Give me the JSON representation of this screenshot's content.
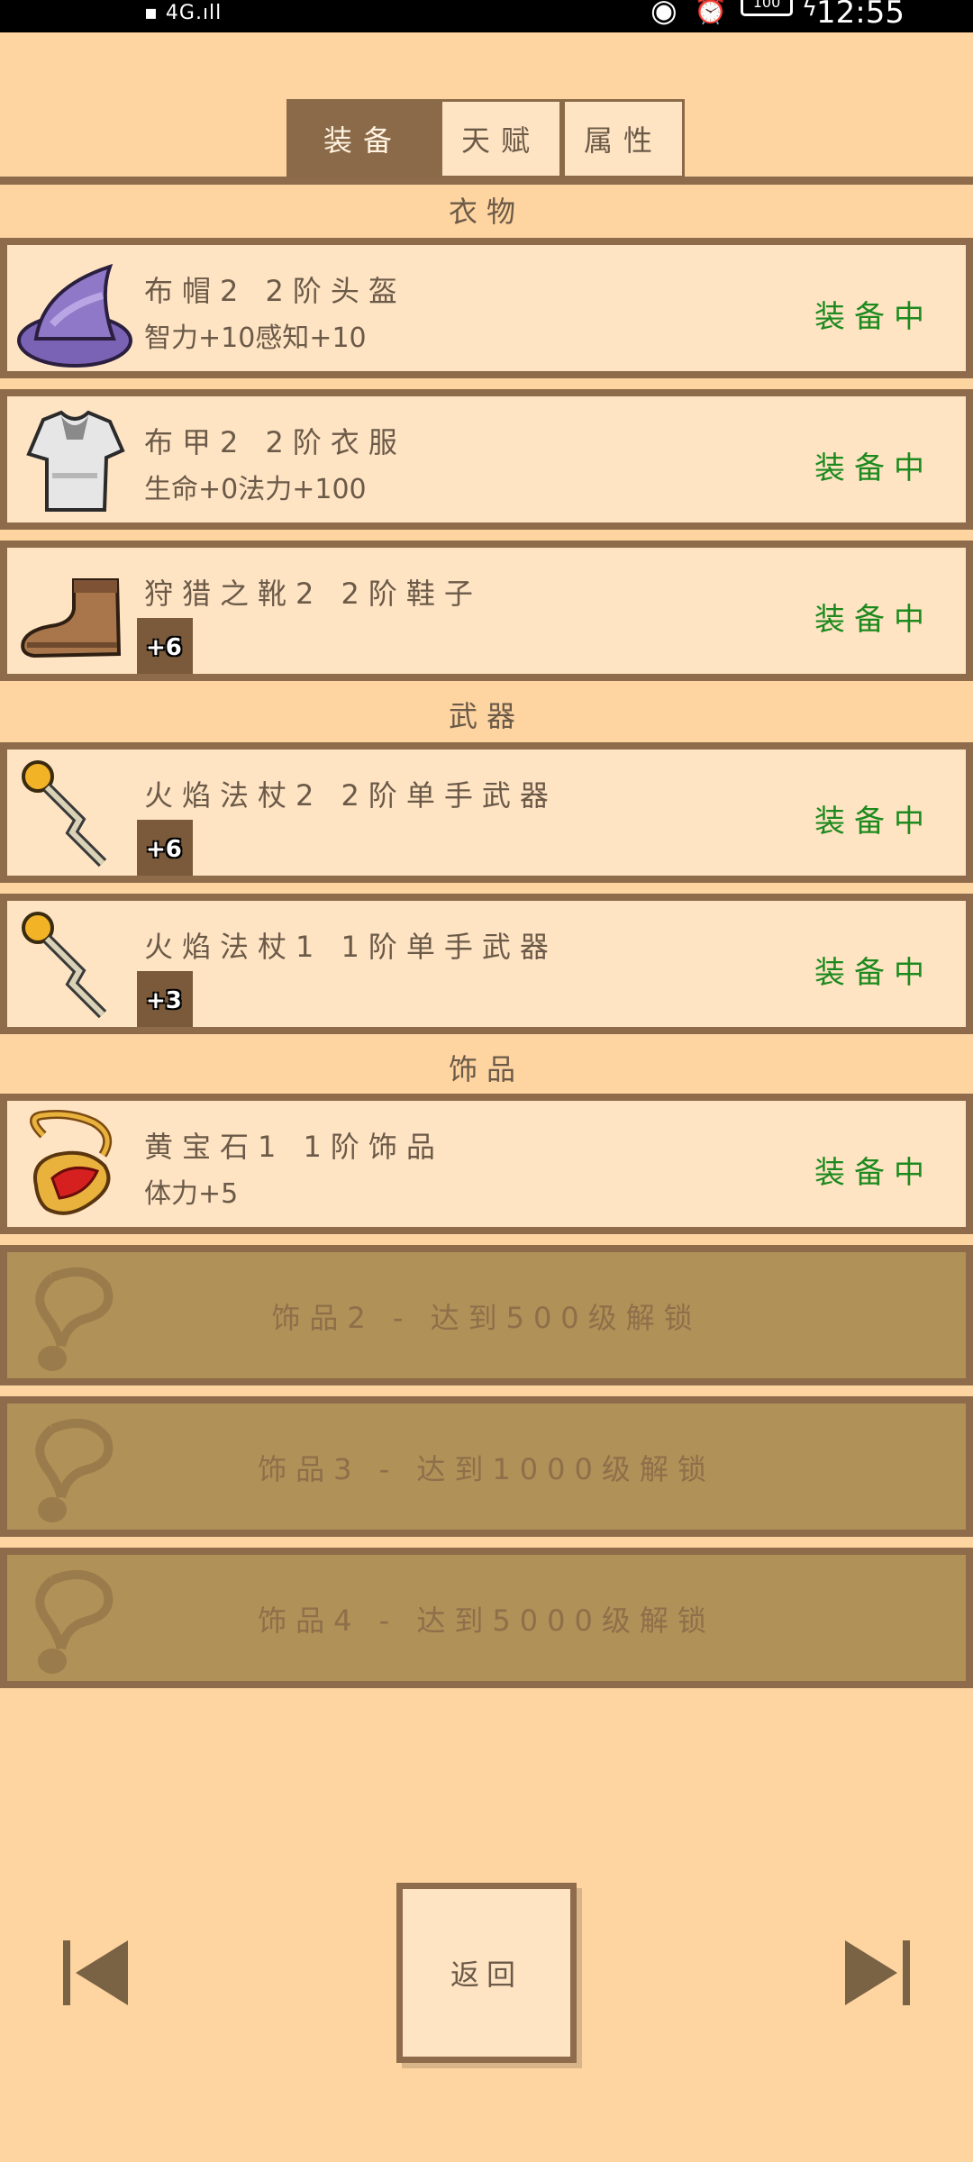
{
  "status_bar": {
    "signal": "▪ 4G.ıll",
    "battery": "100",
    "time": "12:55"
  },
  "tabs": [
    {
      "label": "装备",
      "active": true
    },
    {
      "label": "天赋",
      "active": false
    },
    {
      "label": "属性",
      "active": false
    }
  ],
  "sections": {
    "clothes": "衣物",
    "weapons": "武器",
    "accessories": "饰品"
  },
  "items": [
    {
      "name": "布帽2  2阶头盔",
      "stats": "智力+10感知+10",
      "status": "装备中",
      "icon": "wizard-hat-icon"
    },
    {
      "name": "布甲2  2阶衣服",
      "stats": "生命+0法力+100",
      "status": "装备中",
      "icon": "cloth-shirt-icon"
    },
    {
      "name": "狩猎之靴2  2阶鞋子",
      "rune": "+6",
      "status": "装备中",
      "icon": "boot-icon"
    },
    {
      "name": "火焰法杖2  2阶单手武器",
      "rune": "+6",
      "status": "装备中",
      "icon": "fire-staff-icon"
    },
    {
      "name": "火焰法杖1  1阶单手武器",
      "rune": "+3",
      "status": "装备中",
      "icon": "fire-staff-icon"
    },
    {
      "name": "黄宝石1  1阶饰品",
      "stats": "体力+5",
      "status": "装备中",
      "icon": "amulet-icon"
    }
  ],
  "locked_slots": [
    "饰品2 - 达到500级解锁",
    "饰品3 - 达到1000级解锁",
    "饰品4 - 达到5000级解锁"
  ],
  "footer": {
    "back_label": "返回"
  },
  "colors": {
    "background": "#fed4a1",
    "panel": "#ffe4c4",
    "border": "#8d6b4b",
    "equipped_green": "#1e8a1e",
    "locked": "#b09157"
  }
}
